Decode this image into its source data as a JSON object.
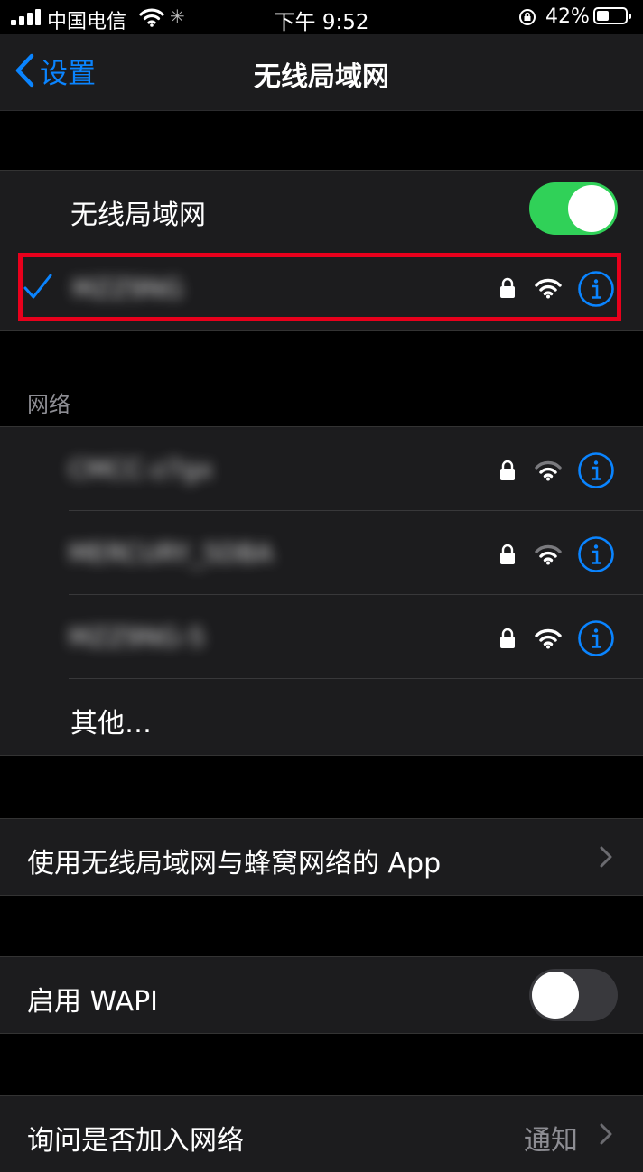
{
  "status_bar": {
    "carrier": "中国电信",
    "time": "下午 9:52",
    "battery_percent": "42%",
    "battery_level": 0.42
  },
  "nav": {
    "back_label": "设置",
    "title": "无线局域网"
  },
  "wifi_toggle": {
    "label": "无线局域网",
    "on": true
  },
  "connected_network": {
    "name": "MZZ9NG",
    "secured": true
  },
  "networks_header": "网络",
  "networks": [
    {
      "name": "CMCC-z7gx",
      "secured": true
    },
    {
      "name": "MERCURY_5DBA",
      "secured": true
    },
    {
      "name": "MZZ9NG-5",
      "secured": true
    }
  ],
  "other_label": "其他…",
  "apps_row": {
    "label": "使用无线局域网与蜂窝网络的 App"
  },
  "wapi_toggle": {
    "label": "启用 WAPI",
    "on": false
  },
  "ask_join": {
    "label": "询问是否加入网络",
    "value": "通知"
  },
  "colors": {
    "accent": "#0a84ff",
    "toggle_on": "#30d158",
    "highlight": "#e8001c"
  }
}
